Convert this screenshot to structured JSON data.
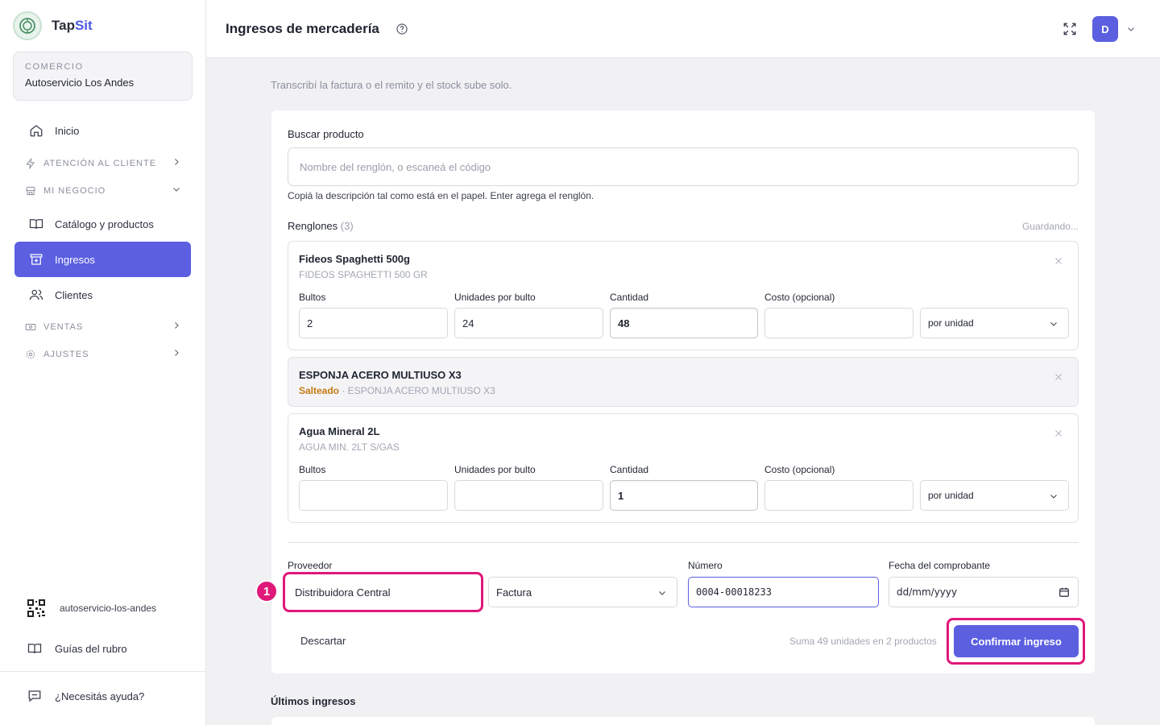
{
  "brand": {
    "name_a": "Tap",
    "name_b": "Sit"
  },
  "store": {
    "label": "COMERCIO",
    "name": "Autoservicio Los Andes"
  },
  "nav": {
    "inicio": "Inicio",
    "atencion": "ATENCIÓN AL CLIENTE",
    "negocio": "MI NEGOCIO",
    "catalogo": "Catálogo y productos",
    "ingresos": "Ingresos",
    "clientes": "Clientes",
    "ventas": "VENTAS",
    "ajustes": "AJUSTES"
  },
  "sidebar_bottom": {
    "slug": "autoservicio-los-andes",
    "guias": "Guías del rubro",
    "ayuda": "¿Necesitás ayuda?"
  },
  "header": {
    "title": "Ingresos de mercadería",
    "avatar": "D"
  },
  "subtitle": "Transcribí la factura o el remito y el stock sube solo.",
  "search": {
    "label": "Buscar producto",
    "placeholder": "Nombre del renglón, o escaneá el código",
    "hint": "Copiá la descripción tal como está en el papel. Enter agrega el renglón."
  },
  "rows_header": {
    "label": "Renglones",
    "count": "(3)",
    "status": "Guardando..."
  },
  "field_labels": {
    "bultos": "Bultos",
    "unidades": "Unidades por bulto",
    "cantidad": "Cantidad",
    "costo": "Costo (opcional)"
  },
  "rows": [
    {
      "title": "Fideos Spaghetti 500g",
      "subtitle": "FIDEOS SPAGHETTI 500 GR",
      "bultos": "2",
      "unidades": "24",
      "cantidad": "48",
      "costo": "",
      "unidad": "por unidad"
    },
    {
      "title": "ESPONJA ACERO MULTIUSO X3",
      "skip_label": "Salteado",
      "subtitle": " · ESPONJA ACERO MULTIUSO X3"
    },
    {
      "title": "Agua Mineral 2L",
      "subtitle": "AGUA MIN. 2LT S/GAS",
      "bultos": "",
      "unidades": "",
      "cantidad": "1",
      "costo": "",
      "unidad": "por unidad"
    }
  ],
  "voucher": {
    "proveedor_label": "Proveedor",
    "proveedor": "Distribuidora Central",
    "tipo": "Factura",
    "numero_label": "Número",
    "numero": "0004-00018233",
    "fecha_label": "Fecha del comprobante",
    "fecha": "dd/mm/yyyy"
  },
  "annotation": {
    "badge": "1"
  },
  "actions": {
    "descartar": "Descartar",
    "summary": "Suma 49 unidades en 2 productos",
    "confirmar": "Confirmar ingreso"
  },
  "ultimos": {
    "title": "Últimos ingresos"
  },
  "colors": {
    "accent": "#5b5fe0",
    "highlight": "#e0187a",
    "skip": "#c47a12"
  }
}
